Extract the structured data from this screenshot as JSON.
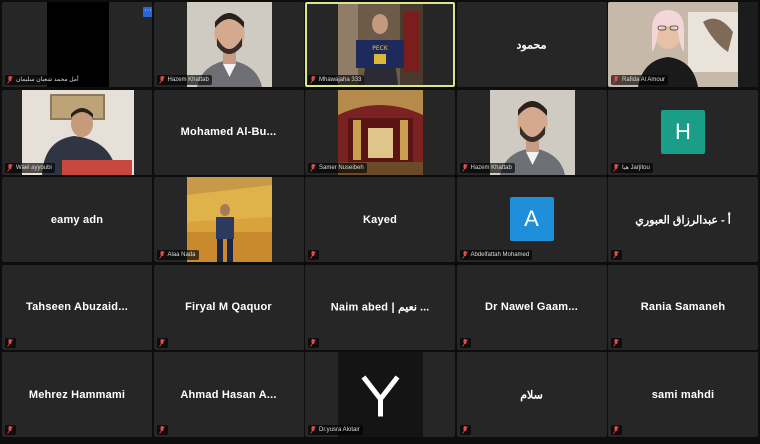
{
  "tiles": [
    {
      "label": "أمل محمد شعبان سليمان"
    },
    {
      "label": "Hazem Khattab"
    },
    {
      "label": "Mhawajaha 333"
    },
    {
      "name": "محمود"
    },
    {
      "label": "Rafida Al Amour"
    },
    {
      "label": "Wael ayyoubi"
    },
    {
      "name": "Mohamed  Al-Bu..."
    },
    {
      "label": "Samer Nuseibeh"
    },
    {
      "label": "Hazem Khattab"
    },
    {
      "label": "هيا Jarjitou",
      "avatar": "H"
    },
    {
      "name": "eamy adn"
    },
    {
      "label": "Alaa Nada"
    },
    {
      "name": "Kayed"
    },
    {
      "label": "Abdelfattah Mohamed",
      "avatar": "A"
    },
    {
      "name": "أ - عبدالرزاق العبوري"
    },
    {
      "name": "Tahseen  Abuzaid..."
    },
    {
      "name": "Firyal M Qaquor"
    },
    {
      "name": "Naim abed | نعيم ..."
    },
    {
      "name": "Dr Nawel  Gaam..."
    },
    {
      "name": "Rania Samaneh"
    },
    {
      "name": "Mehrez Hammami"
    },
    {
      "name": "Ahmad Hasan A..."
    },
    {
      "label": "Dr.yusra Alotair"
    },
    {
      "name": "سلام"
    },
    {
      "name": "sami mahdi"
    }
  ],
  "more_button": "···",
  "colors": {
    "tile_bg": "#262626",
    "active_border": "#d9e68a",
    "avatar_h": "#1a9e87",
    "avatar_a": "#1e8fd8",
    "mic_muted": "#e34b4b"
  }
}
